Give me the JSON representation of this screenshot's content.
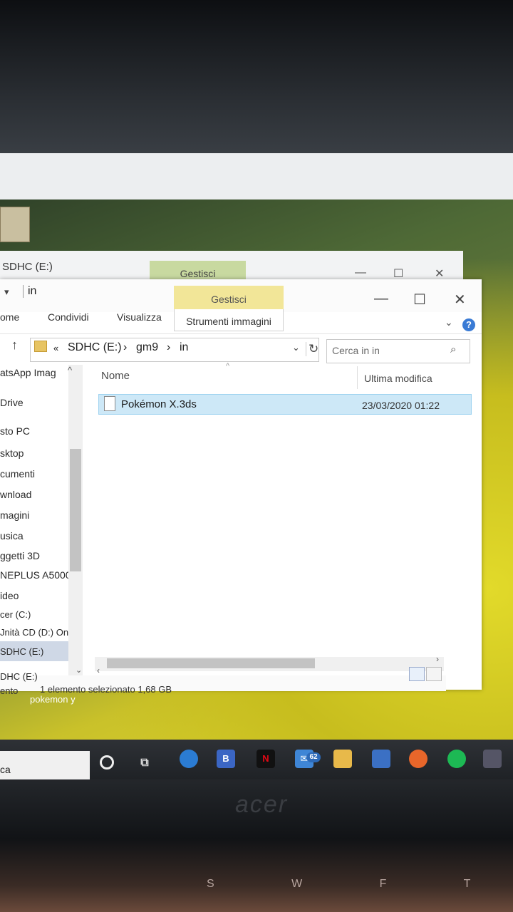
{
  "background_window": {
    "title": "SDHC (E:)",
    "tab_gestisci": "Gestisci"
  },
  "window": {
    "quick_access_path": "in",
    "tab_gestisci": "Gestisci",
    "minimize": "—",
    "maximize": "☐",
    "close": "✕"
  },
  "ribbon": {
    "tabs": [
      "ome",
      "Condividi",
      "Visualizza",
      "Strumenti immagini"
    ],
    "help": "?"
  },
  "address": {
    "crumbs": [
      "«",
      "SDHC (E:)",
      "›",
      "gm9",
      "›",
      "in"
    ],
    "search_placeholder": "Cerca in in"
  },
  "nav": {
    "items": [
      "atsApp Imag",
      "Drive",
      "sto PC",
      "sktop",
      "cumenti",
      "wnload",
      "magini",
      "usica",
      "ggetti 3D",
      "NEPLUS A5000",
      "ideo",
      "cer (C:)",
      "Jnità CD (D:) On",
      "SDHC (E:)",
      "DHC (E:)"
    ]
  },
  "columns": {
    "name": "Nome",
    "modified": "Ultima modifica"
  },
  "files": [
    {
      "name": "Pokémon X.3ds",
      "modified": "23/03/2020 01:22"
    }
  ],
  "status": {
    "left_partial": "ento",
    "selection": "1 elemento selezionato  1,68 GB",
    "behind_text": "pokemon y"
  },
  "taskbar": {
    "search_partial": "ca",
    "mail_badge": "62"
  },
  "photo": {
    "laptop_brand": "acer",
    "keys": "S W F T"
  }
}
